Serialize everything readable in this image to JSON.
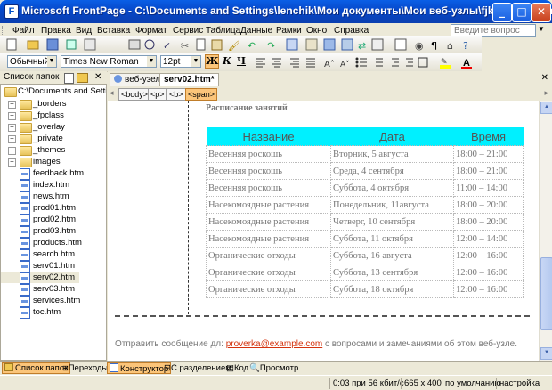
{
  "window": {
    "title": "Microsoft FrontPage - C:\\Documents and Settings\\lenchik\\Мои документы\\Мои веб-узлы\\fjk\\serv02.htm",
    "controls": [
      "_",
      "□",
      "✕"
    ]
  },
  "menu": {
    "items": [
      "Файл",
      "Правка",
      "Вид",
      "Вставка",
      "Формат",
      "Сервис",
      "Таблица",
      "Данные",
      "Рамки",
      "Окно",
      "Справка"
    ],
    "ask_placeholder": "Введите вопрос"
  },
  "format_bar": {
    "style": "Обычный",
    "font": "Times New Roman",
    "size": "12pt",
    "bold": "Ж",
    "italic": "К",
    "underline": "Ч"
  },
  "folder_panel": {
    "title": "Список папок",
    "root": "C:\\Documents and Settings\\",
    "folders": [
      "_borders",
      "_fpclass",
      "_overlay",
      "_private",
      "_themes",
      "images"
    ],
    "files": [
      "feedback.htm",
      "index.htm",
      "news.htm",
      "prod01.htm",
      "prod02.htm",
      "prod03.htm",
      "products.htm",
      "search.htm",
      "serv01.htm",
      "serv02.htm",
      "serv03.htm",
      "services.htm",
      "toc.htm"
    ]
  },
  "tabs": [
    "веб-узел",
    "serv02.htm*"
  ],
  "tag_path": [
    "<body>",
    "<p>",
    "<b>",
    "<span>"
  ],
  "page": {
    "heading": "Расписание занятий",
    "table": {
      "headers": [
        "Название",
        "Дата",
        "Время"
      ],
      "rows": [
        [
          "Весенняя роскошь",
          "Вторник, 5 августа",
          "18:00 – 21:00"
        ],
        [
          "Весенняя роскошь",
          "Среда, 4 сентября",
          "18:00 – 21:00"
        ],
        [
          "Весенняя роскошь",
          "Суббота, 4 октября",
          "11:00 – 14:00"
        ],
        [
          "Насекомоядные растения",
          "Понедельник, 11августа",
          "18:00 – 20:00"
        ],
        [
          "Насекомоядные растения",
          "Четверг, 10 сентября",
          "18:00 – 20:00"
        ],
        [
          "Насекомоядные растения",
          "Суббота, 11 октября",
          "12:00 – 14:00"
        ],
        [
          "Органические отходы",
          "Суббота, 16 августа",
          "12:00 – 16:00"
        ],
        [
          "Органические отходы",
          "Суббота, 13 сентября",
          "12:00 – 16:00"
        ],
        [
          "Органические отходы",
          "Суббота, 18 октября",
          "12:00 – 16:00"
        ]
      ]
    },
    "footer_before": "Отправить сообщение дл: ",
    "footer_email": "proverka@example.com",
    "footer_after": " с вопросами и замечаниями об этом веб-узле."
  },
  "view_bar": {
    "folder_list": "Список папок",
    "navigation": "Переходы",
    "design": "Конструктор",
    "split": "С разделением",
    "code": "Код",
    "preview": "Просмотр"
  },
  "status_bar": {
    "speed": "0:03 при 56 кбит/с",
    "size": "665 x 400",
    "mode": "по умолчанию",
    "custom": "настройка"
  },
  "colors": {
    "title_bar": "#0a5fe6",
    "table_header": "#00f0ff",
    "link": "#d4330e",
    "active_view": "#fbc57a"
  }
}
